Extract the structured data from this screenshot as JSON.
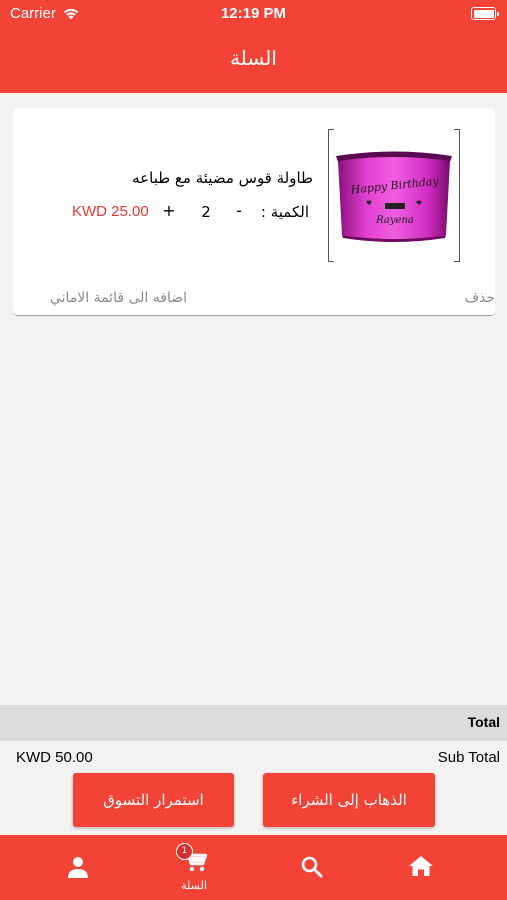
{
  "status_bar": {
    "carrier": "Carrier",
    "time": "12:19 PM"
  },
  "header": {
    "title": "السلة"
  },
  "cart_item": {
    "name": "طاولة قوس مضيئة مع طباعه",
    "quantity_label": "الكمية :",
    "minus": "-",
    "quantity": "2",
    "plus": "+",
    "price": "KWD  25.00",
    "image_text": {
      "line1": "Happy Birthday",
      "line2": "Rayena"
    },
    "add_to_wishlist": "اضافه الى قائمة الاماني",
    "delete": "حذف"
  },
  "summary": {
    "total_label": "Total",
    "subtotal_value": "KWD  50.00",
    "subtotal_label": "Sub Total"
  },
  "buttons": {
    "continue_shopping": "استمرار التسوق",
    "checkout": "الذهاب إلى الشراء"
  },
  "tab_bar": {
    "cart_label": "السلة",
    "cart_badge": "1",
    "icons": [
      "person-icon",
      "cart-icon",
      "search-icon",
      "home-icon"
    ]
  },
  "colors": {
    "brand": "#f34336",
    "price": "#e53935",
    "background": "#f2f2f2"
  }
}
